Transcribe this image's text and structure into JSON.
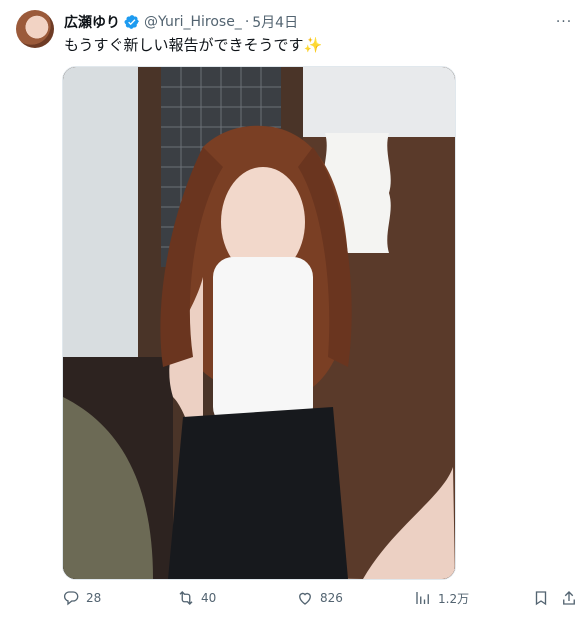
{
  "tweet": {
    "display_name": "広瀬ゆり",
    "handle": "@Yuri_Hirose_",
    "separator": "·",
    "date": "5月4日",
    "text": "もうすぐ新しい報告ができそうです",
    "emoji": "✨",
    "more_label": "···"
  },
  "metrics": {
    "replies": "28",
    "reposts": "40",
    "likes": "826",
    "views": "1.2万"
  },
  "colors": {
    "verified": "#1d9bf0",
    "muted": "#536471",
    "text": "#0f1419"
  },
  "icons": {
    "reply": "reply-icon",
    "repost": "repost-icon",
    "like": "heart-icon",
    "views": "views-icon",
    "bookmark": "bookmark-icon",
    "share": "share-icon"
  }
}
